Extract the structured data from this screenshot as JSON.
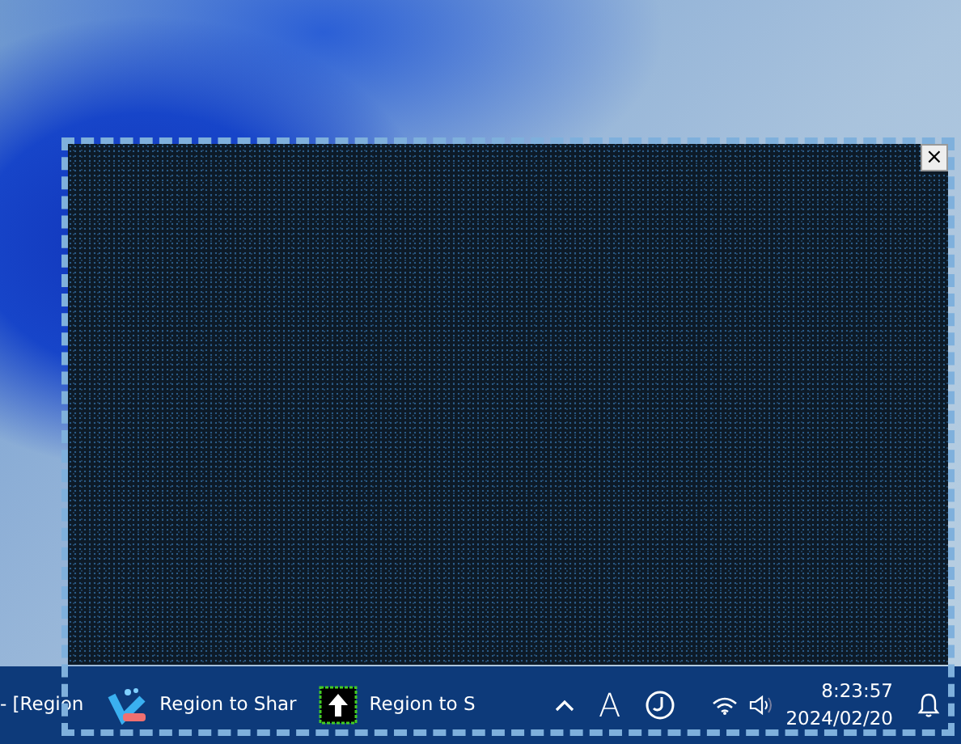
{
  "capture_region": {
    "close_glyph": "×"
  },
  "taskbar": {
    "apps": [
      {
        "kind": "text",
        "label": "- [Region"
      },
      {
        "kind": "brush",
        "label": "Region to Shar"
      },
      {
        "kind": "upload",
        "label": "Region to S"
      }
    ],
    "ime_indicator": "A",
    "clock": {
      "time": "8:23:57",
      "date": "2024/02/20"
    }
  }
}
